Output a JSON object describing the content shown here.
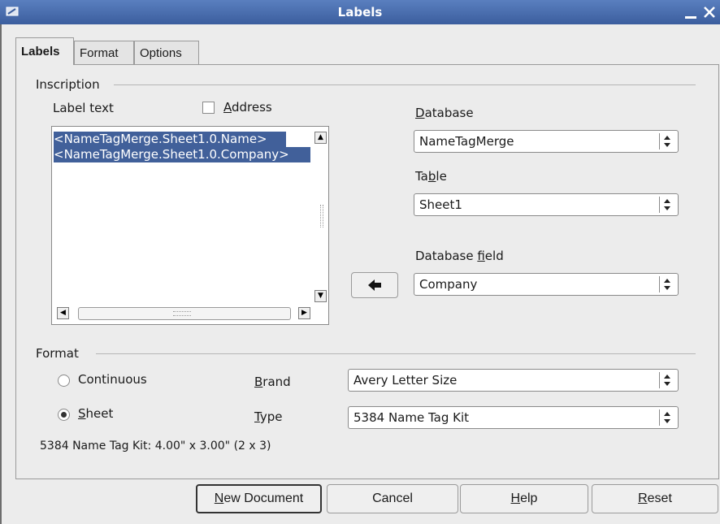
{
  "window": {
    "title": "Labels"
  },
  "tabs": [
    {
      "label": "Labels",
      "active": true
    },
    {
      "label": "Format",
      "active": false
    },
    {
      "label": "Options",
      "active": false
    }
  ],
  "inscription": {
    "group_title": "Inscription",
    "label_text_caption": "Label text",
    "address_checkbox": {
      "label": "Address",
      "checked": false
    },
    "label_lines": [
      "<NameTagMerge.Sheet1.0.Name>",
      "<NameTagMerge.Sheet1.0.Company>"
    ],
    "database_label": "Database",
    "database_value": "NameTagMerge",
    "table_label": "Table",
    "table_value": "Sheet1",
    "db_field_label": "Database field",
    "db_field_value": "Company",
    "insert_arrow_icon": "left-arrow-icon"
  },
  "format": {
    "group_title": "Format",
    "continuous_label": "Continuous",
    "sheet_label": "Sheet",
    "selected_mode": "Sheet",
    "brand_label": "Brand",
    "brand_value": "Avery Letter Size",
    "type_label": "Type",
    "type_value": "5384 Name Tag Kit",
    "info_text": "5384 Name Tag Kit: 4.00\" x 3.00\" (2 x 3)"
  },
  "buttons": {
    "new_document": "New Document",
    "cancel": "Cancel",
    "help": "Help",
    "reset": "Reset"
  },
  "colors": {
    "titlebar": "#4a6fae",
    "selection": "#41609a"
  }
}
